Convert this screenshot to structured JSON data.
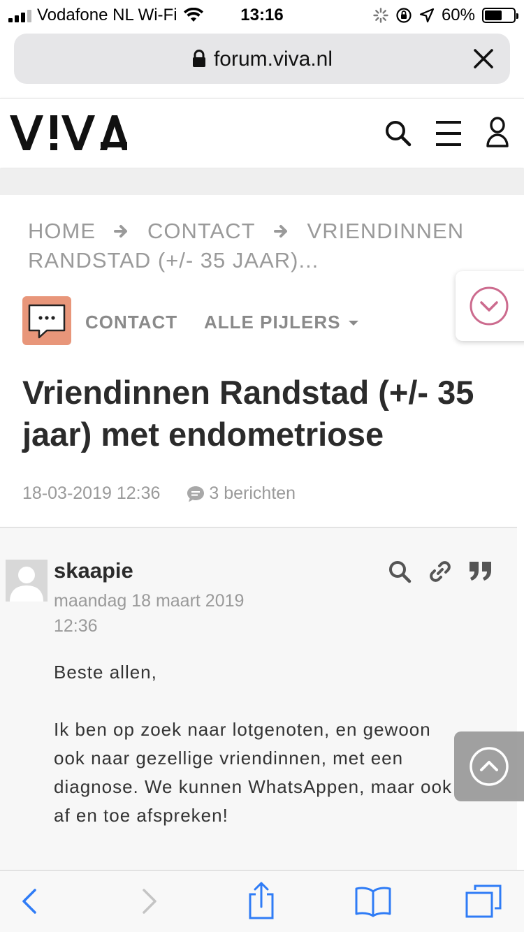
{
  "status_bar": {
    "carrier": "Vodafone NL Wi-Fi",
    "time": "13:16",
    "battery": "60%",
    "battery_level": 0.6
  },
  "browser": {
    "url": "forum.viva.nl",
    "lock_icon": "lock-icon",
    "close_icon": "close-icon"
  },
  "site": {
    "logo": "V!VA",
    "icons": [
      "search-icon",
      "menu-icon",
      "user-icon"
    ]
  },
  "breadcrumb": {
    "items": [
      "HOME",
      "CONTACT",
      "VRIENDINNEN RANDSTAD (+/- 35 JAAR)..."
    ]
  },
  "category": {
    "name": "CONTACT",
    "pillars_label": "ALLE PIJLERS",
    "accent_color": "#e8967a"
  },
  "topic": {
    "title_line1": "Vriendinnen Randstad (+/- 35",
    "title_line2": "jaar) met endometriose",
    "date": "18-03-2019 12:36",
    "message_count": "3 berichten"
  },
  "post": {
    "author": "skaapie",
    "date_line1": "maandag 18 maart 2019",
    "date_line2": "12:36",
    "paragraphs": [
      "Beste allen,",
      "Ik ben op zoek naar lotgenoten, en gewoon ook naar gezellige vriendinnen, met een diagnose. We kunnen WhatsAppen, maar ook af en toe afspreken!"
    ]
  },
  "colors": {
    "pink_accent": "#cc6b8e",
    "ios_blue": "#2f7cf6"
  }
}
